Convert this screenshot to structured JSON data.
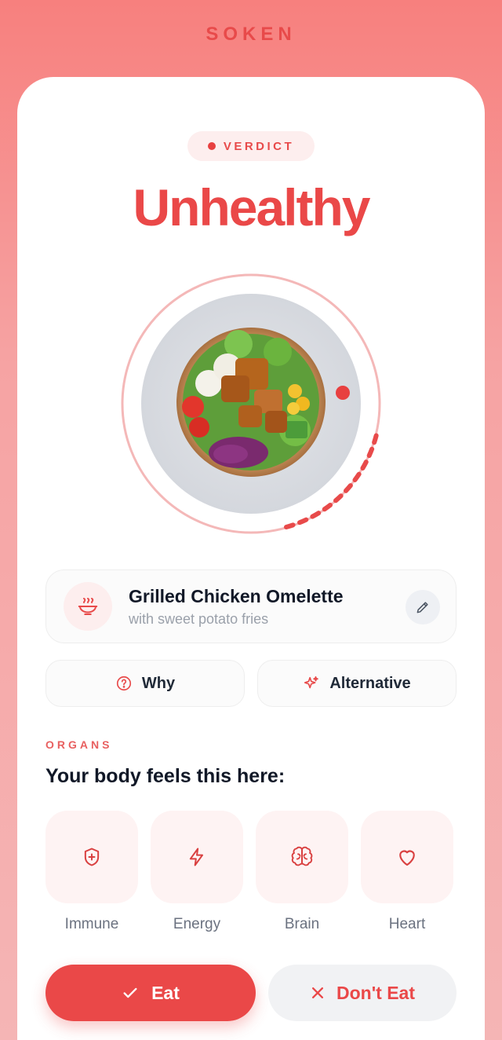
{
  "app": {
    "brand": "SOKEN"
  },
  "verdict": {
    "label": "VERDICT",
    "value": "Unhealthy"
  },
  "colors": {
    "accent": "#ea4848",
    "tile": "#fef3f3",
    "text": "#111827",
    "muted": "#9aa0aa"
  },
  "food": {
    "name": "Grilled Chicken Omelette",
    "subtitle": "with sweet potato fries",
    "icon": "bowl-icon",
    "edit_icon": "pencil-icon"
  },
  "actions": {
    "why_label": "Why",
    "why_icon": "question-circle-icon",
    "alternative_label": "Alternative",
    "alternative_icon": "sparkles-icon"
  },
  "organs": {
    "label": "ORGANS",
    "title": "Your body feels this here:",
    "items": [
      {
        "label": "Immune",
        "icon": "shield-plus-icon"
      },
      {
        "label": "Energy",
        "icon": "lightning-icon"
      },
      {
        "label": "Brain",
        "icon": "brain-icon"
      },
      {
        "label": "Heart",
        "icon": "heart-icon"
      }
    ]
  },
  "decision": {
    "eat_label": "Eat",
    "eat_icon": "check-icon",
    "dont_eat_label": "Don't Eat",
    "dont_eat_icon": "x-icon"
  }
}
